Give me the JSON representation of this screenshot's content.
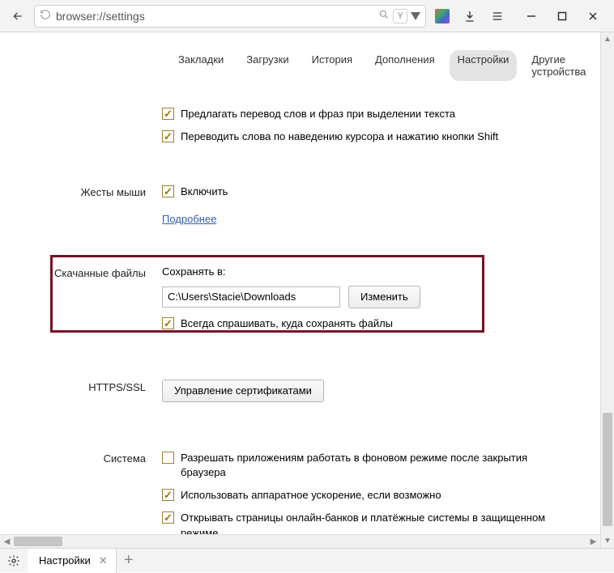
{
  "toolbar": {
    "address": "browser://settings"
  },
  "tabs": {
    "items": [
      "Закладки",
      "Загрузки",
      "История",
      "Дополнения",
      "Настройки",
      "Другие устройства"
    ],
    "active_index": 4
  },
  "sections": {
    "translate": {
      "opt1": "Предлагать перевод слов и фраз при выделении текста",
      "opt2": "Переводить слова по наведению курсора и нажатию кнопки Shift"
    },
    "mouse_gestures": {
      "label": "Жесты мыши",
      "enable": "Включить",
      "more": "Подробнее"
    },
    "downloads": {
      "label": "Скачанные файлы",
      "save_to": "Сохранять в:",
      "path": "C:\\Users\\Stacie\\Downloads",
      "change": "Изменить",
      "ask": "Всегда спрашивать, куда сохранять файлы"
    },
    "https": {
      "label": "HTTPS/SSL",
      "manage": "Управление сертификатами"
    },
    "system": {
      "label": "Система",
      "bg": "Разрешать приложениям работать в фоновом режиме после закрытия браузера",
      "hw": "Использовать аппаратное ускорение, если возможно",
      "bank": "Открывать страницы онлайн-банков и платёжные системы в защищенном режиме"
    }
  },
  "bottom_tab": {
    "title": "Настройки"
  }
}
